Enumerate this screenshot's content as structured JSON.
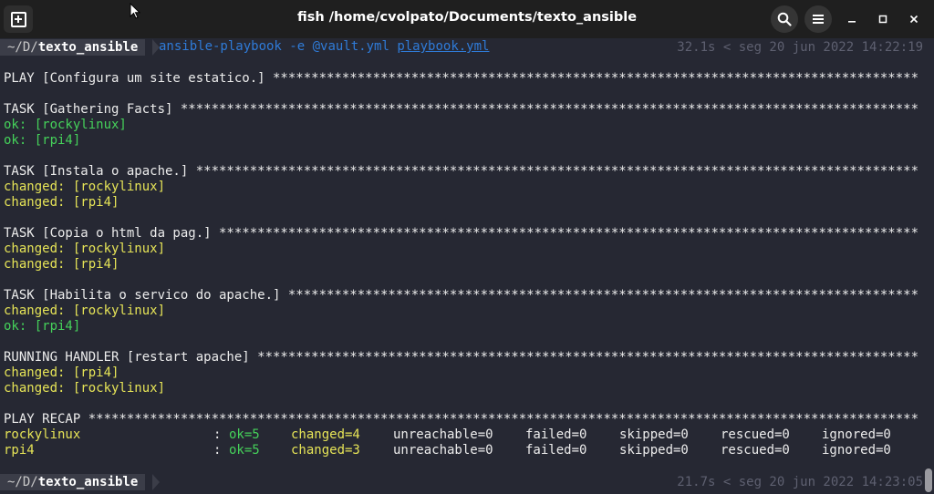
{
  "window": {
    "title": "fish /home/cvolpato/Documents/texto_ansible"
  },
  "prompt1": {
    "dir_prefix": "~/D/",
    "dir_name": "texto_ansible",
    "command": "ansible-playbook",
    "flag": "-e",
    "vault_arg": "@vault.yml",
    "playbook": "playbook.yml",
    "right": "32.1s < seg 20 jun 2022 14:22:19"
  },
  "output": {
    "play": "PLAY [Configura um site estatico.] ************************************************************************************",
    "task1": "TASK [Gathering Facts] ************************************************************************************************",
    "task1_r1": "ok: [rockylinux]",
    "task1_r2": "ok: [rpi4]",
    "task2": "TASK [Instala o apache.] **********************************************************************************************",
    "task2_r1": "changed: [rockylinux]",
    "task2_r2": "changed: [rpi4]",
    "task3": "TASK [Copia o html da pag.] *******************************************************************************************",
    "task3_r1": "changed: [rockylinux]",
    "task3_r2": "changed: [rpi4]",
    "task4": "TASK [Habilita o servico do apache.] **********************************************************************************",
    "task4_r1": "changed: [rockylinux]",
    "task4_r2": "ok: [rpi4]",
    "handler": "RUNNING HANDLER [restart apache] **************************************************************************************",
    "handler_r1": "changed: [rpi4]",
    "handler_r2": "changed: [rockylinux]",
    "recap": "PLAY RECAP ************************************************************************************************************"
  },
  "recap_rows": [
    {
      "host": "rockylinux",
      "sep": ":",
      "ok": "ok=5",
      "changed": "changed=4",
      "unreachable": "unreachable=0",
      "failed": "failed=0",
      "skipped": "skipped=0",
      "rescued": "rescued=0",
      "ignored": "ignored=0"
    },
    {
      "host": "rpi4",
      "sep": ":",
      "ok": "ok=5",
      "changed": "changed=3",
      "unreachable": "unreachable=0",
      "failed": "failed=0",
      "skipped": "skipped=0",
      "rescued": "rescued=0",
      "ignored": "ignored=0"
    }
  ],
  "prompt2": {
    "dir_prefix": "~/D/",
    "dir_name": "texto_ansible",
    "right": "21.7s < seg 20 jun 2022 14:23:05"
  },
  "icons": [
    "new-tab-icon",
    "search-icon",
    "menu-icon",
    "minimize-icon",
    "maximize-icon",
    "close-icon",
    "mouse-cursor-icon"
  ],
  "colors": {
    "background": "#262833",
    "ok": "#45d15a",
    "changed": "#e6e457",
    "command": "#2f7bd8"
  }
}
